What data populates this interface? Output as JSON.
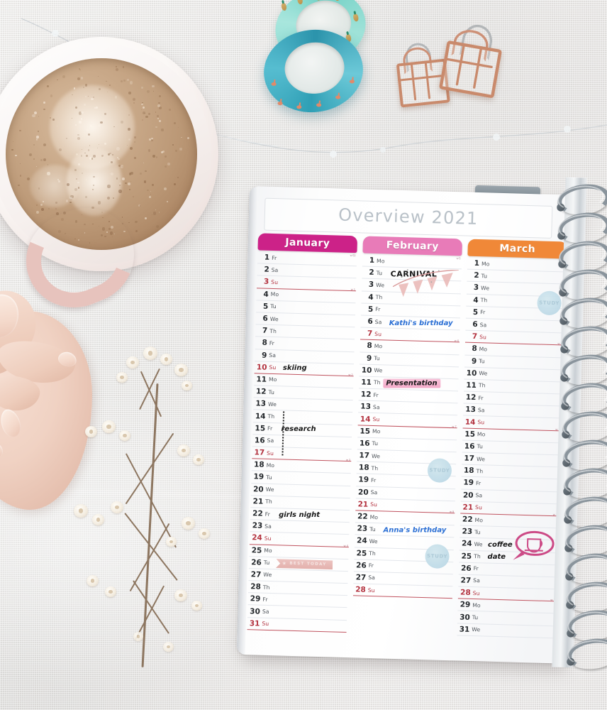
{
  "scene": {
    "description": "flat-lay desk photo",
    "surface": "white linen tablecloth"
  },
  "objects": {
    "mug": {
      "name": "coffee-mug",
      "color": "#e2b5af",
      "contents": "latte with foam"
    },
    "hand": {
      "name": "hand-holding-mug"
    },
    "washi_tapes": [
      {
        "name": "washi-tape-pineapple",
        "color": "#7fd8cd",
        "pattern": "gold pineapples"
      },
      {
        "name": "washi-tape-flamingo",
        "color": "#2f9fb5",
        "pattern": "flamingos"
      }
    ],
    "binder_clips": [
      {
        "name": "binder-clip-small",
        "color": "#c98a6c"
      },
      {
        "name": "binder-clip-large",
        "color": "#c98a6c"
      }
    ],
    "fairy_lights": {
      "name": "fairy-light-wire"
    },
    "dried_flowers": {
      "name": "babys-breath-sprig"
    }
  },
  "planner": {
    "title": "Overview 2021",
    "tab_label": "",
    "binding": "silver spiral",
    "months": [
      {
        "name": "January",
        "color": "#cc2288",
        "week_label": "w 53",
        "days": [
          {
            "n": "1",
            "dow": "Fr"
          },
          {
            "n": "2",
            "dow": "Sa"
          },
          {
            "n": "3",
            "dow": "Su",
            "sunday": true,
            "week": "w 1"
          },
          {
            "n": "4",
            "dow": "Mo"
          },
          {
            "n": "5",
            "dow": "Tu"
          },
          {
            "n": "6",
            "dow": "We"
          },
          {
            "n": "7",
            "dow": "Th"
          },
          {
            "n": "8",
            "dow": "Fr"
          },
          {
            "n": "9",
            "dow": "Sa"
          },
          {
            "n": "10",
            "dow": "Su",
            "sunday": true,
            "week": "w 2",
            "entry": "skiing",
            "style": "black"
          },
          {
            "n": "11",
            "dow": "Mo"
          },
          {
            "n": "12",
            "dow": "Tu"
          },
          {
            "n": "13",
            "dow": "We"
          },
          {
            "n": "14",
            "dow": "Th"
          },
          {
            "n": "15",
            "dow": "Fr",
            "entry": "research",
            "style": "black"
          },
          {
            "n": "16",
            "dow": "Sa"
          },
          {
            "n": "17",
            "dow": "Su",
            "sunday": true,
            "week": "w 3"
          },
          {
            "n": "18",
            "dow": "Mo"
          },
          {
            "n": "19",
            "dow": "Tu"
          },
          {
            "n": "20",
            "dow": "We"
          },
          {
            "n": "21",
            "dow": "Th"
          },
          {
            "n": "22",
            "dow": "Fr",
            "entry": "girls night",
            "style": "black"
          },
          {
            "n": "23",
            "dow": "Sa"
          },
          {
            "n": "24",
            "dow": "Su",
            "sunday": true,
            "week": "w 4"
          },
          {
            "n": "25",
            "dow": "Mo"
          },
          {
            "n": "26",
            "dow": "Tu",
            "sticker": "banner"
          },
          {
            "n": "27",
            "dow": "We"
          },
          {
            "n": "28",
            "dow": "Th"
          },
          {
            "n": "29",
            "dow": "Fr"
          },
          {
            "n": "30",
            "dow": "Sa"
          },
          {
            "n": "31",
            "dow": "Su",
            "sunday": true
          }
        ]
      },
      {
        "name": "February",
        "color": "#e87bb8",
        "week_label": "w 5",
        "days": [
          {
            "n": "1",
            "dow": "Mo"
          },
          {
            "n": "2",
            "dow": "Tu",
            "entry": "CARNIVAL",
            "style": "black"
          },
          {
            "n": "3",
            "dow": "We"
          },
          {
            "n": "4",
            "dow": "Th"
          },
          {
            "n": "5",
            "dow": "Fr"
          },
          {
            "n": "6",
            "dow": "Sa",
            "entry": "Kathi's birthday",
            "style": "blue"
          },
          {
            "n": "7",
            "dow": "Su",
            "sunday": true,
            "week": "w 6"
          },
          {
            "n": "8",
            "dow": "Mo"
          },
          {
            "n": "9",
            "dow": "Tu"
          },
          {
            "n": "10",
            "dow": "We"
          },
          {
            "n": "11",
            "dow": "Th",
            "entry": "Presentation",
            "style": "highlight"
          },
          {
            "n": "12",
            "dow": "Fr"
          },
          {
            "n": "13",
            "dow": "Sa"
          },
          {
            "n": "14",
            "dow": "Su",
            "sunday": true,
            "week": "w 7"
          },
          {
            "n": "15",
            "dow": "Mo"
          },
          {
            "n": "16",
            "dow": "Tu"
          },
          {
            "n": "17",
            "dow": "We"
          },
          {
            "n": "18",
            "dow": "Th",
            "sticker": "study"
          },
          {
            "n": "19",
            "dow": "Fr"
          },
          {
            "n": "20",
            "dow": "Sa"
          },
          {
            "n": "21",
            "dow": "Su",
            "sunday": true,
            "week": "w 8"
          },
          {
            "n": "22",
            "dow": "Mo"
          },
          {
            "n": "23",
            "dow": "Tu",
            "entry": "Anna's birthday",
            "style": "blue"
          },
          {
            "n": "24",
            "dow": "We"
          },
          {
            "n": "25",
            "dow": "Th",
            "sticker": "study"
          },
          {
            "n": "26",
            "dow": "Fr"
          },
          {
            "n": "27",
            "dow": "Sa"
          },
          {
            "n": "28",
            "dow": "Su",
            "sunday": true
          }
        ]
      },
      {
        "name": "March",
        "color": "#f08838",
        "week_label": "w 9",
        "days": [
          {
            "n": "1",
            "dow": "Mo"
          },
          {
            "n": "2",
            "dow": "Tu"
          },
          {
            "n": "3",
            "dow": "We"
          },
          {
            "n": "4",
            "dow": "Th",
            "sticker": "study"
          },
          {
            "n": "5",
            "dow": "Fr"
          },
          {
            "n": "6",
            "dow": "Sa"
          },
          {
            "n": "7",
            "dow": "Su",
            "sunday": true,
            "week": "w 10"
          },
          {
            "n": "8",
            "dow": "Mo"
          },
          {
            "n": "9",
            "dow": "Tu"
          },
          {
            "n": "10",
            "dow": "We"
          },
          {
            "n": "11",
            "dow": "Th"
          },
          {
            "n": "12",
            "dow": "Fr"
          },
          {
            "n": "13",
            "dow": "Sa"
          },
          {
            "n": "14",
            "dow": "Su",
            "sunday": true,
            "week": "w 11"
          },
          {
            "n": "15",
            "dow": "Mo"
          },
          {
            "n": "16",
            "dow": "Tu"
          },
          {
            "n": "17",
            "dow": "We"
          },
          {
            "n": "18",
            "dow": "Th"
          },
          {
            "n": "19",
            "dow": "Fr"
          },
          {
            "n": "20",
            "dow": "Sa"
          },
          {
            "n": "21",
            "dow": "Su",
            "sunday": true,
            "week": "w 12"
          },
          {
            "n": "22",
            "dow": "Mo"
          },
          {
            "n": "23",
            "dow": "Tu"
          },
          {
            "n": "24",
            "dow": "We",
            "entry": "coffee",
            "style": "black"
          },
          {
            "n": "25",
            "dow": "Th",
            "entry": "date",
            "style": "black",
            "sticker": "coffee"
          },
          {
            "n": "26",
            "dow": "Fr"
          },
          {
            "n": "27",
            "dow": "Sa"
          },
          {
            "n": "28",
            "dow": "Su",
            "sunday": true,
            "week": "w 13"
          },
          {
            "n": "29",
            "dow": "Mo"
          },
          {
            "n": "30",
            "dow": "Tu"
          },
          {
            "n": "31",
            "dow": "We"
          }
        ]
      }
    ],
    "stickers": {
      "study_label": "STUDY",
      "banner_label": "BEST TODAY",
      "banner_star": "★",
      "bunting_name": "carnival-bunting",
      "coffee_name": "coffee-cup-speech-bubble"
    }
  }
}
